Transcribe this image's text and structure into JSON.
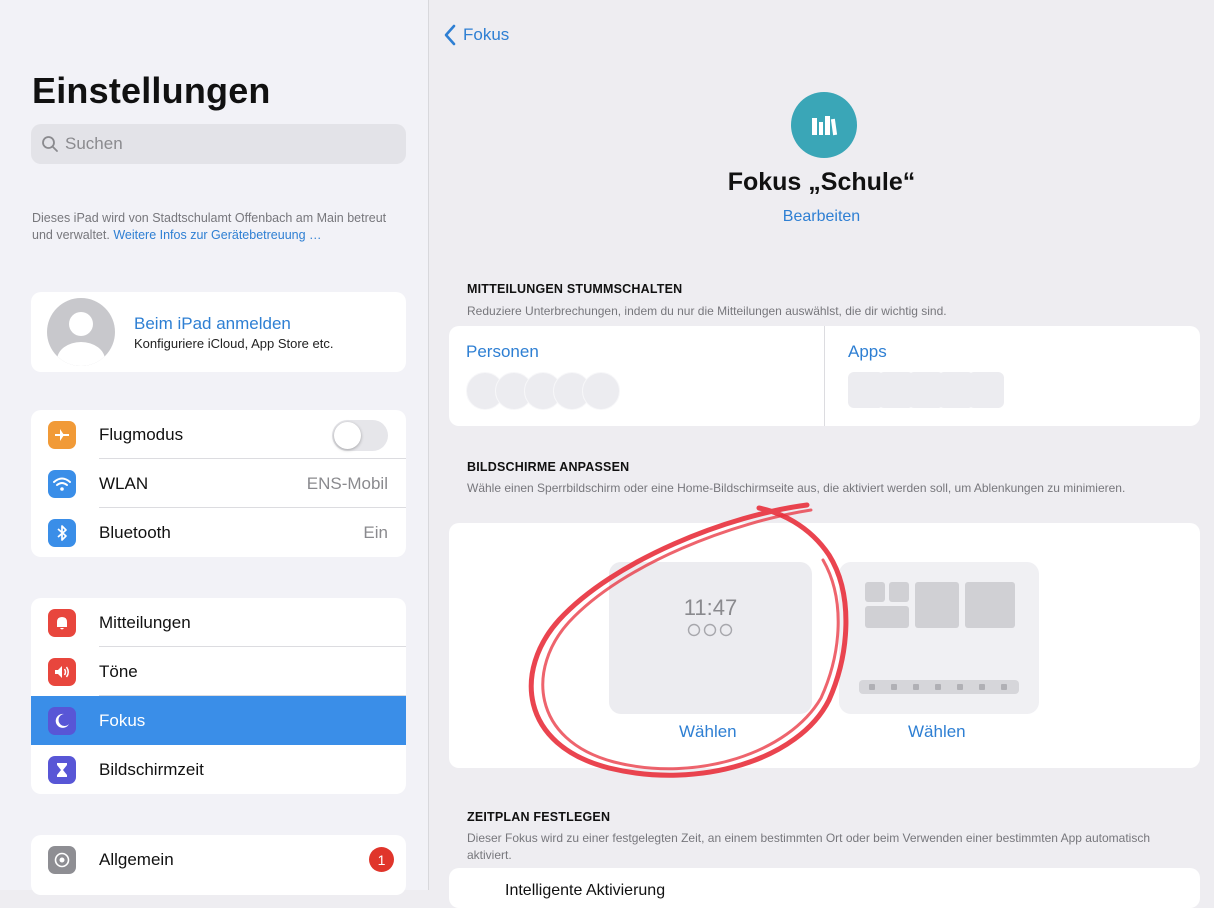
{
  "sidebar": {
    "title": "Einstellungen",
    "search_placeholder": "Suchen",
    "management_note": "Dieses iPad wird von Stadtschulamt Offenbach am Main betreut und verwaltet.",
    "management_link": "Weitere Infos zur Gerätebetreuung …",
    "account": {
      "title": "Beim iPad anmelden",
      "subtitle": "Konfiguriere iCloud, App Store etc."
    },
    "group1": [
      {
        "label": "Flugmodus",
        "icon": "airplane-icon",
        "icon_color": "#f19a37",
        "control": "toggle",
        "toggle_on": false
      },
      {
        "label": "WLAN",
        "icon": "wifi-icon",
        "icon_color": "#3a8ee8",
        "value": "ENS-Mobil"
      },
      {
        "label": "Bluetooth",
        "icon": "bluetooth-icon",
        "icon_color": "#3a8ee8",
        "value": "Ein"
      }
    ],
    "group2": [
      {
        "label": "Mitteilungen",
        "icon": "bell-icon",
        "icon_color": "#e8463d"
      },
      {
        "label": "Töne",
        "icon": "speaker-icon",
        "icon_color": "#e8463d"
      },
      {
        "label": "Fokus",
        "icon": "moon-icon",
        "icon_color": "#5856d6",
        "selected": true
      },
      {
        "label": "Bildschirmzeit",
        "icon": "hourglass-icon",
        "icon_color": "#5856d6"
      }
    ],
    "group3": [
      {
        "label": "Allgemein",
        "icon": "gear-icon",
        "icon_color": "#8e8e93",
        "badge": "1"
      }
    ]
  },
  "detail": {
    "back_label": "Fokus",
    "focus_icon": "books-icon",
    "focus_title": "Fokus „Schule“",
    "edit_label": "Bearbeiten",
    "silence": {
      "heading": "MITTEILUNGEN STUMMSCHALTEN",
      "description": "Reduziere Unterbrechungen, indem du nur die Mitteilungen auswählst, die dir wichtig sind.",
      "people_label": "Personen",
      "apps_label": "Apps"
    },
    "screens": {
      "heading": "BILDSCHIRME ANPASSEN",
      "description": "Wähle einen Sperrbildschirm oder eine Home-Bildschirmseite aus, die aktiviert werden soll, um Ablenkungen zu minimieren.",
      "lock_time": "11:47",
      "choose_lock": "Wählen",
      "choose_home": "Wählen"
    },
    "schedule": {
      "heading": "ZEITPLAN FESTLEGEN",
      "description": "Dieser Fokus wird zu einer festgelegten Zeit, an einem bestimmten Ort oder beim Verwenden einer bestimmten App automatisch aktiviert.",
      "first_item": "Intelligente Aktivierung"
    }
  },
  "colors": {
    "accent": "#2e7fd3",
    "selected_row": "#3a8ee8",
    "focus_icon_bg": "#3aa6b7",
    "annotation": "#e8303c",
    "badge": "#e0352b"
  }
}
